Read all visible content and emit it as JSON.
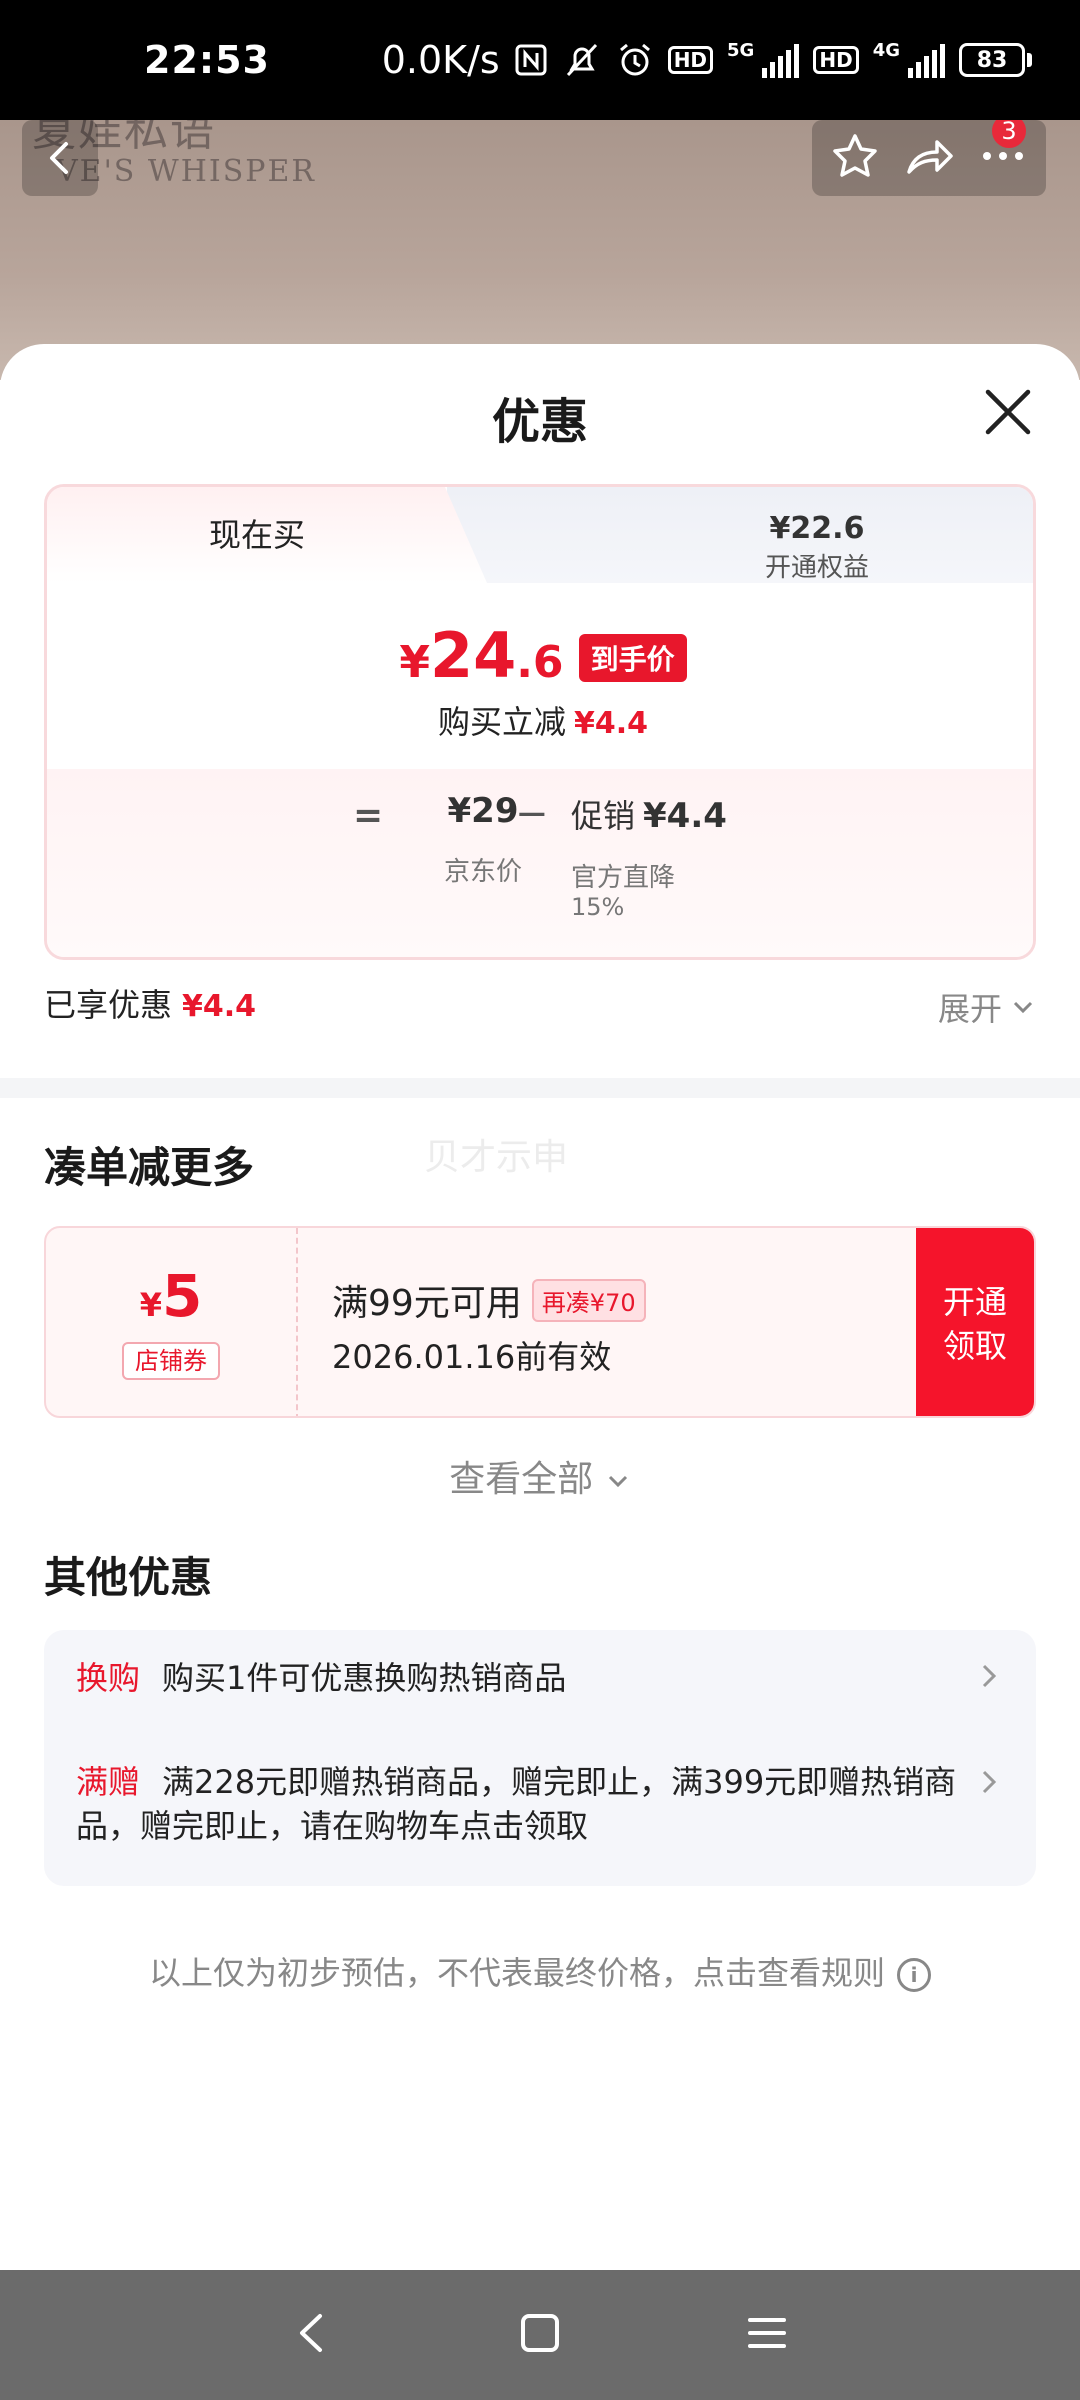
{
  "status_bar": {
    "time": "22:53",
    "net_speed": "0.0K/s",
    "sim1_type": "5G",
    "sim2_type": "4G",
    "hd_label": "HD",
    "battery": "83"
  },
  "nav": {
    "brand_cn": "夏娃私语",
    "brand_en": "VE'S WHISPER",
    "badge_count": "3"
  },
  "sheet": {
    "title": "优惠"
  },
  "price_card": {
    "tab_buy_now": "现在买",
    "tab_member_price": "¥22.6",
    "tab_member_label": "开通权益",
    "final_yen": "¥",
    "final_int": "24",
    "final_dec": ".6",
    "final_tag": "到手价",
    "save_text": "购买立减",
    "save_amount": "¥4.4",
    "eq": "=",
    "jd_price": "¥29",
    "jd_label": "京东价",
    "minus": "−",
    "promo_label": "促销",
    "promo_amount": "¥4.4",
    "promo_sub": "官方直降",
    "promo_pct": "15%"
  },
  "enjoyed": {
    "label": "已享优惠",
    "amount": "¥4.4",
    "expand": "展开"
  },
  "bundle": {
    "title": "凑单减更多",
    "watermark": "贝才示申"
  },
  "coupon": {
    "yen": "¥",
    "amount": "5",
    "type": "店铺券",
    "condition": "满99元可用",
    "more_tag": "再凑¥70",
    "valid": "2026.01.16前有效",
    "button": "开通领取"
  },
  "view_all": "查看全部",
  "other": {
    "title": "其他优惠",
    "items": [
      {
        "tag": "换购",
        "text": "购买1件可优惠换购热销商品"
      },
      {
        "tag": "满赠",
        "text": "满228元即赠热销商品，赠完即止，满399元即赠热销商品，赠完即止，请在购物车点击领取"
      }
    ]
  },
  "footer_note": "以上仅为初步预估，不代表最终价格，点击查看规则",
  "colors": {
    "accent_red": "#e8172c",
    "button_red": "#f5142b",
    "sheet_bg": "#ffffff",
    "sysnav_bg": "#6b6b6b"
  }
}
